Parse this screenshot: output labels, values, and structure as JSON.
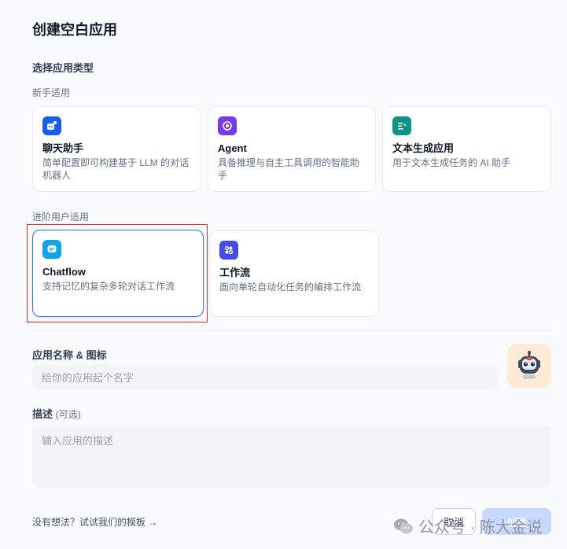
{
  "page": {
    "title": "创建空白应用",
    "app_type_label": "选择应用类型",
    "beginner_label": "新手适用",
    "advanced_label": "进阶用户适用"
  },
  "app_types": {
    "beginner": [
      {
        "title": "聊天助手",
        "desc": "简单配置即可构建基于 LLM 的对话机器人",
        "icon": "chat-bot-icon",
        "color": "#155eef"
      },
      {
        "title": "Agent",
        "desc": "具备推理与自主工具调用的智能助手",
        "icon": "agent-icon",
        "color": "#7839ee"
      },
      {
        "title": "文本生成应用",
        "desc": "用于文本生成任务的 AI 助手",
        "icon": "text-generation-icon",
        "color": "#0e9384"
      }
    ],
    "advanced": [
      {
        "title": "Chatflow",
        "desc": "支持记忆的复杂多轮对话工作流",
        "icon": "chatflow-icon",
        "color": "#0ba5ec",
        "selected": true
      },
      {
        "title": "工作流",
        "desc": "面向单轮自动化任务的编排工作流",
        "icon": "workflow-icon",
        "color": "#444ce7"
      }
    ]
  },
  "form": {
    "name_label": "应用名称 & 图标",
    "name_placeholder": "给你的应用起个名字",
    "name_value": "",
    "avatar_icon": "robot-avatar-icon",
    "desc_label": "描述",
    "desc_optional": "(可选)",
    "desc_placeholder": "输入应用的描述",
    "desc_value": ""
  },
  "footer": {
    "template_link": "没有想法？试试我们的模板 →",
    "cancel_label": "取消",
    "create_label": "创建"
  },
  "watermark": {
    "text": "公众号 · 陈大金说",
    "icon": "wechat-icon"
  }
}
